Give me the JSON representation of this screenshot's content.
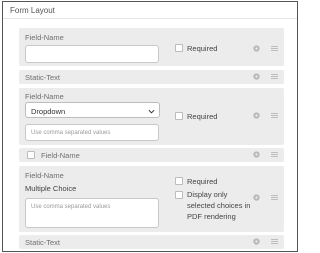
{
  "header": {
    "title": "Form Layout"
  },
  "rows": {
    "r1": {
      "label": "Field-Name",
      "required_label": "Required"
    },
    "r2": {
      "label": "Static-Text"
    },
    "r3": {
      "label": "Field-Name",
      "dropdown_value": "Dropdown",
      "values_placeholder": "Use comma separated values",
      "required_label": "Required"
    },
    "r4": {
      "label": "Field-Name"
    },
    "r5": {
      "label": "Field-Name",
      "type_label": "Multiple Choice",
      "values_placeholder": "Use comma separated values",
      "required_label": "Required",
      "display_only_label": "Display only",
      "display_only_label_2": "selected choices in",
      "display_only_label_3": "PDF rendering"
    },
    "r6": {
      "label": "Static-Text"
    }
  },
  "icons": {
    "gear": "gear-icon",
    "drag": "drag-handle-icon",
    "caret": "chevron-down-icon"
  }
}
